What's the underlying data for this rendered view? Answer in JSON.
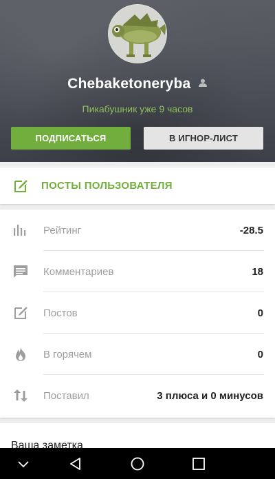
{
  "profile": {
    "username": "Chebaketoneryba",
    "since": "Пикабушник уже 9 часов",
    "subscribe_label": "ПОДПИСАТЬСЯ",
    "ignore_label": "В ИГНОР-ЛИСТ"
  },
  "posts_link": {
    "label": "ПОСТЫ ПОЛЬЗОВАТЕЛЯ",
    "icon": "edit-icon"
  },
  "stats": [
    {
      "label": "Рейтинг",
      "value": "-28.5",
      "icon": "bar-chart-icon"
    },
    {
      "label": "Комментариев",
      "value": "18",
      "icon": "comment-icon"
    },
    {
      "label": "Постов",
      "value": "0",
      "icon": "edit-icon"
    },
    {
      "label": "В горячем",
      "value": "0",
      "icon": "fire-icon"
    },
    {
      "label": "Поставил",
      "value": "3 плюса и 0 минусов",
      "icon": "sort-arrows-icon"
    }
  ],
  "note": {
    "label": "Ваша заметка"
  },
  "navbar": {
    "buttons": [
      "chevron-down-icon",
      "back-triangle-icon",
      "home-circle-icon",
      "recents-square-icon"
    ]
  },
  "colors": {
    "accent": "#72ae3e",
    "since_text": "#8fbf5c",
    "icon_gray": "#9e9e9e"
  }
}
